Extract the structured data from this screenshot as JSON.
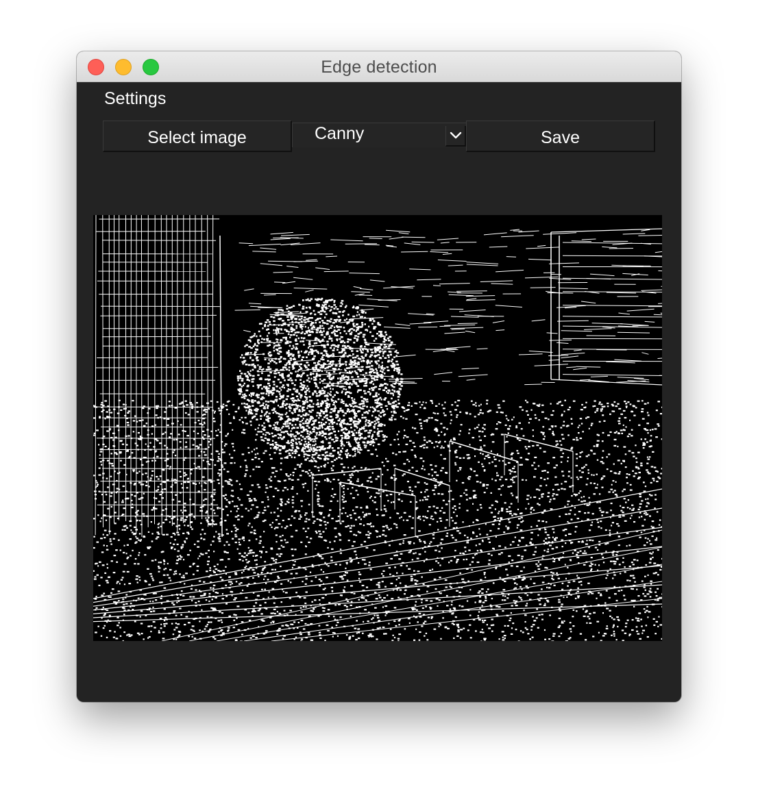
{
  "window": {
    "title": "Edge detection",
    "controls": [
      "close",
      "minimize",
      "maximize"
    ]
  },
  "menu": {
    "settings_label": "Settings"
  },
  "toolbar": {
    "select_image_label": "Select image",
    "method_selected": "Canny",
    "method_dropdown_icon": "chevron-down-icon",
    "save_label": "Save"
  },
  "preview": {
    "description_icon": "edge-detected-image",
    "colors": {
      "background": "#000000",
      "edges": "#ffffff"
    }
  },
  "colors": {
    "window_bg": "#232323",
    "titlebar": "#e3e3e3",
    "close": "#fe5f57",
    "minimize": "#febc2e",
    "maximize": "#28c840"
  }
}
